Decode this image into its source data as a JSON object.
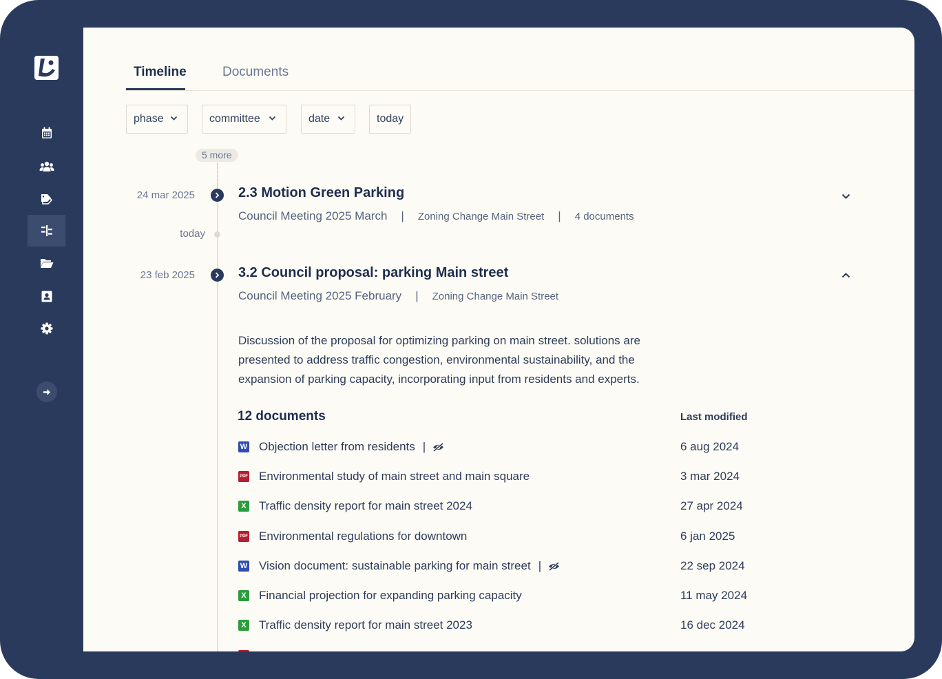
{
  "app": {
    "nav_items": [
      {
        "icon": "calendar-icon",
        "active": false
      },
      {
        "icon": "users-icon",
        "active": false
      },
      {
        "icon": "tags-icon",
        "active": false
      },
      {
        "icon": "timeline-icon",
        "active": true
      },
      {
        "icon": "folder-open-icon",
        "active": false
      },
      {
        "icon": "contact-card-icon",
        "active": false
      },
      {
        "icon": "gear-icon",
        "active": false
      }
    ],
    "colors": {
      "sidebar": "#2a3a5c",
      "content_bg": "#fdfbf5",
      "word": "#2e4fb0",
      "pdf": "#b3202f",
      "excel": "#2a9d3c"
    }
  },
  "tabs": [
    {
      "label": "Timeline",
      "active": true
    },
    {
      "label": "Documents",
      "active": false
    }
  ],
  "filters": {
    "phase": "phase",
    "committee": "committee",
    "date": "date",
    "today": "today"
  },
  "timeline": {
    "more_label": "5 more",
    "today_label": "today",
    "entries": [
      {
        "date": "24 mar 2025",
        "title": "2.3 Motion Green Parking",
        "meeting": "Council Meeting 2025 March",
        "dossier": "Zoning Change Main Street",
        "doc_count": "4 documents",
        "expanded": false
      },
      {
        "date": "23 feb 2025",
        "title": "3.2 Council proposal: parking Main street",
        "meeting": "Council Meeting 2025 February",
        "dossier": "Zoning Change Main Street",
        "expanded": true,
        "description": "Discussion of the proposal for optimizing parking on main street. solutions are presented to address traffic congestion, environmental sustainability, and the expansion of parking capacity, incorporating input from residents and experts.",
        "documents_heading": "12 documents",
        "last_modified_heading": "Last modified",
        "documents": [
          {
            "type": "word",
            "icon_label": "W",
            "name": "Objection letter from residents",
            "hidden": true,
            "modified": "6 aug 2024"
          },
          {
            "type": "pdf",
            "icon_label": "PDF",
            "name": "Environmental study of main street and main square",
            "hidden": false,
            "modified": "3 mar 2024"
          },
          {
            "type": "excel",
            "icon_label": "X",
            "name": "Traffic density report for main street 2024",
            "hidden": false,
            "modified": "27 apr 2024"
          },
          {
            "type": "pdf",
            "icon_label": "PDF",
            "name": "Environmental regulations for downtown",
            "hidden": false,
            "modified": "6 jan 2025"
          },
          {
            "type": "word",
            "icon_label": "W",
            "name": "Vision document: sustainable parking for main street",
            "hidden": true,
            "modified": "22 sep 2024"
          },
          {
            "type": "excel",
            "icon_label": "X",
            "name": "Financial projection for expanding parking capacity",
            "hidden": false,
            "modified": "11 may 2024"
          },
          {
            "type": "excel",
            "icon_label": "X",
            "name": "Traffic density report for main street 2023",
            "hidden": false,
            "modified": "16 dec 2024"
          }
        ]
      }
    ]
  }
}
